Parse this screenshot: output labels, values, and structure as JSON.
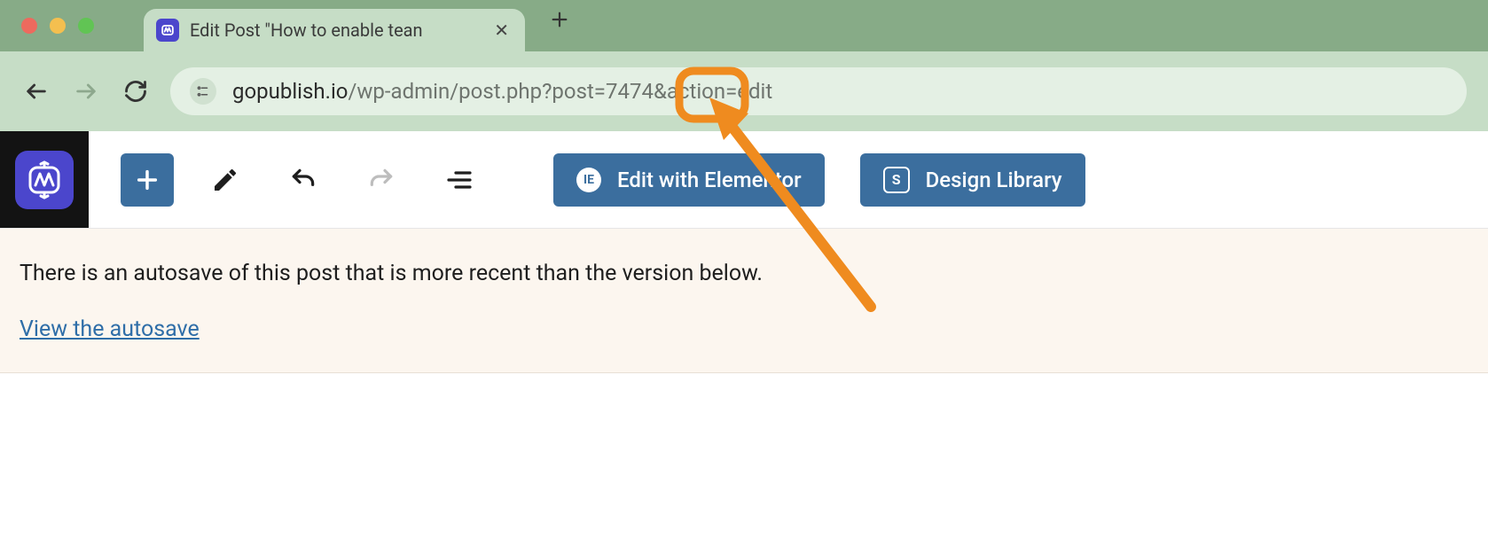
{
  "browser": {
    "tab_title": "Edit Post \"How to enable tean",
    "url_host": "gopublish.io",
    "url_path": "/wp-admin/post.php?post=",
    "url_highlighted_param": "7474",
    "url_rest": "&action=edit"
  },
  "editor": {
    "elementor_label": "Edit with Elementor",
    "design_library_label": "Design Library"
  },
  "notice": {
    "message": "There is an autosave of this post that is more recent than the version below.",
    "link_text": "View the autosave"
  },
  "annotation": {
    "color": "#ef8b1f",
    "highlighted_value": "7474"
  }
}
